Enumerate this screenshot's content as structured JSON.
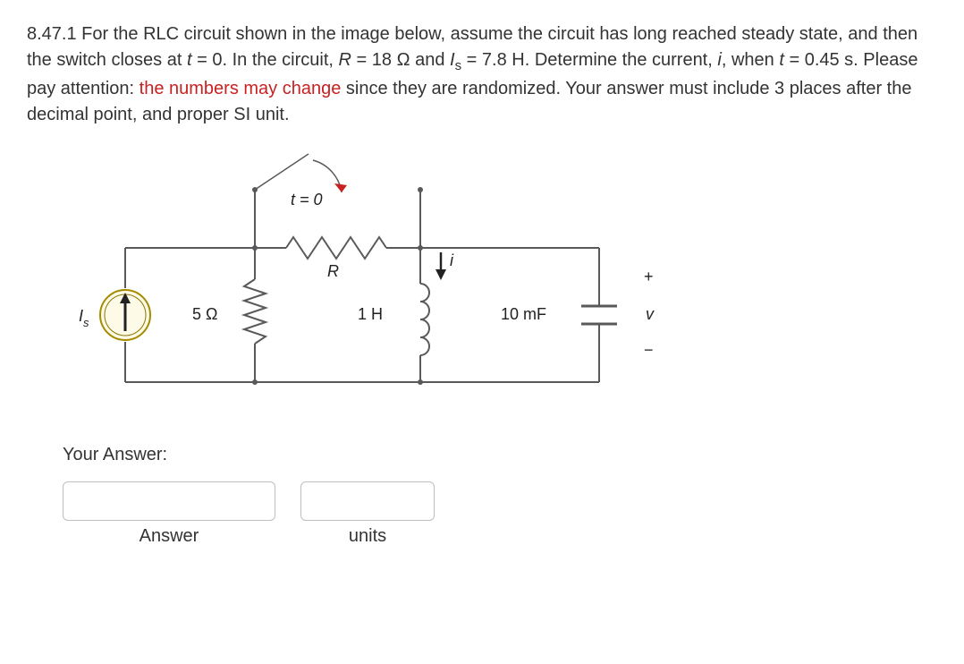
{
  "problem": {
    "number": "8.47.1",
    "intro": "For the RLC circuit shown in the image below, assume the circuit has long reached steady state, and then the switch closes at",
    "t_eq": "t",
    "eq_zero_text": "= 0. In the circuit,",
    "R_sym": "R",
    "R_eq_val": "= 18",
    "ohm_and": "Ω and",
    "Is_sym_I": "I",
    "Is_sub": "s",
    "Is_val": "= 7.8 H. Determine the current,",
    "i_sym": "i",
    "when_text": ", when",
    "t_sym2": "t",
    "t_val_text": "= 0.45 s. Please pay attention:",
    "red_warn": "the numbers may change",
    "tail": "since they are randomized. Your answer must include 3 places after the decimal point, and proper SI unit."
  },
  "circuit": {
    "switch_label": "t = 0",
    "R_label": "R",
    "Is_label_I": "I",
    "Is_label_sub": "s",
    "r5_label": "5 Ω",
    "L_label": "1 H",
    "C_label": "10 mF",
    "i_label": "i",
    "v_label": "v",
    "plus": "+",
    "minus": "−"
  },
  "answer_section": {
    "your_answer": "Your Answer:",
    "answer_caption": "Answer",
    "units_caption": "units"
  }
}
